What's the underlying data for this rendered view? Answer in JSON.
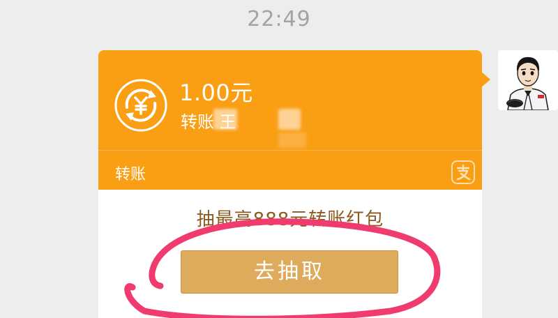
{
  "timestamp": "22:49",
  "message": {
    "amount": "1.00元",
    "memo": "转账 王",
    "type_label": "转账",
    "promo_text": "抽最高888元转账红包",
    "action_label": "去抽取",
    "app_icon": "alipay-icon",
    "transfer_icon": "yuan-exchange-icon"
  },
  "colors": {
    "bubble_orange": "#fa9e14",
    "button_gold": "#deaa5b",
    "promo_brown": "#8a5a1f",
    "annotation_red": "#f03b6e",
    "background": "#ededed"
  }
}
